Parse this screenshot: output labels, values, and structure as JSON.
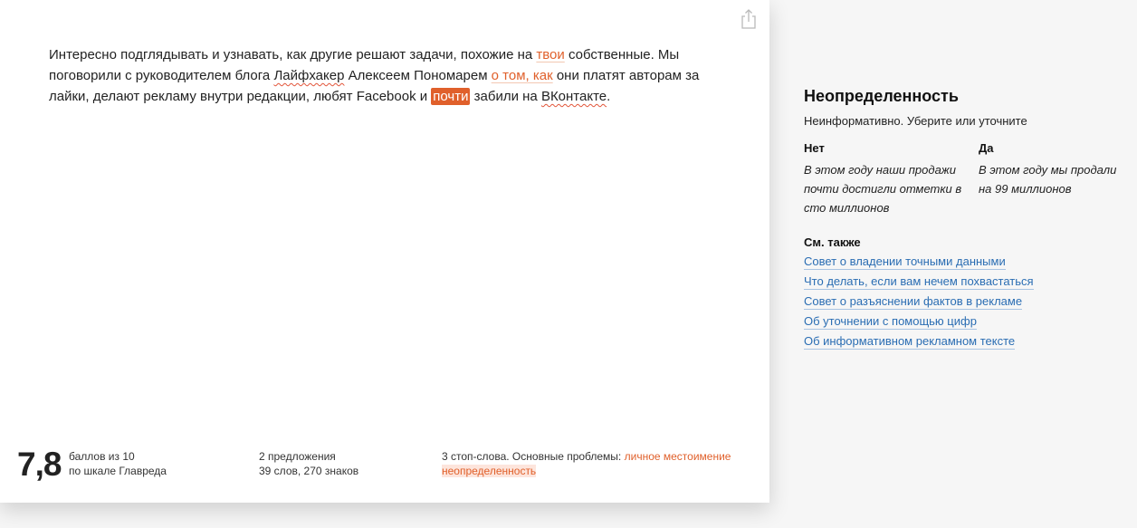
{
  "editor": {
    "text": {
      "s1": "Интересно подглядывать и узнавать, как другие решают задачи, похожие на ",
      "hl1": "твои",
      "s2": " собственные. Мы поговорили с руководителем блога ",
      "hl2": "Лайфхакер",
      "s3": " Алексеем Пономарем ",
      "hl3": "о том, как",
      "s4": " они платят авторам за лайки, делают рекламу внутри редакции, любят Facebook и ",
      "hl4": "почти",
      "s5": " забили на ",
      "hl5": "ВКонтакте",
      "s6": "."
    },
    "share_icon": "share-icon"
  },
  "stats": {
    "score": "7,8",
    "score_line1": "баллов из 10",
    "score_line2": "по шкале Главреда",
    "count_line1": "2 предложения",
    "count_line2": "39 слов, 270 знаков",
    "problems_prefix": "3 стоп-слова. Основные проблемы: ",
    "problem1": "личное местоимение",
    "problem2": "неопределенность"
  },
  "sidebar": {
    "title": "Неопределенность",
    "subtitle": "Неинформативно. Уберите или уточните",
    "no_head": "Нет",
    "no_text": "В этом году наши продажи почти достигли отметки в сто миллионов",
    "yes_head": "Да",
    "yes_text": "В этом году мы продали на 99 миллионов",
    "see_also": "См. также",
    "links": [
      "Совет о владении точными данными",
      "Что делать, если вам нечем похвастаться",
      "Совет о разъяснении фактов в рекламе",
      "Об уточнении с помощью цифр",
      "Об информативном рекламном тексте"
    ]
  },
  "colors": {
    "accent": "#e0602b",
    "link": "#2a6db3",
    "panel_bg": "#f6f6f6"
  }
}
